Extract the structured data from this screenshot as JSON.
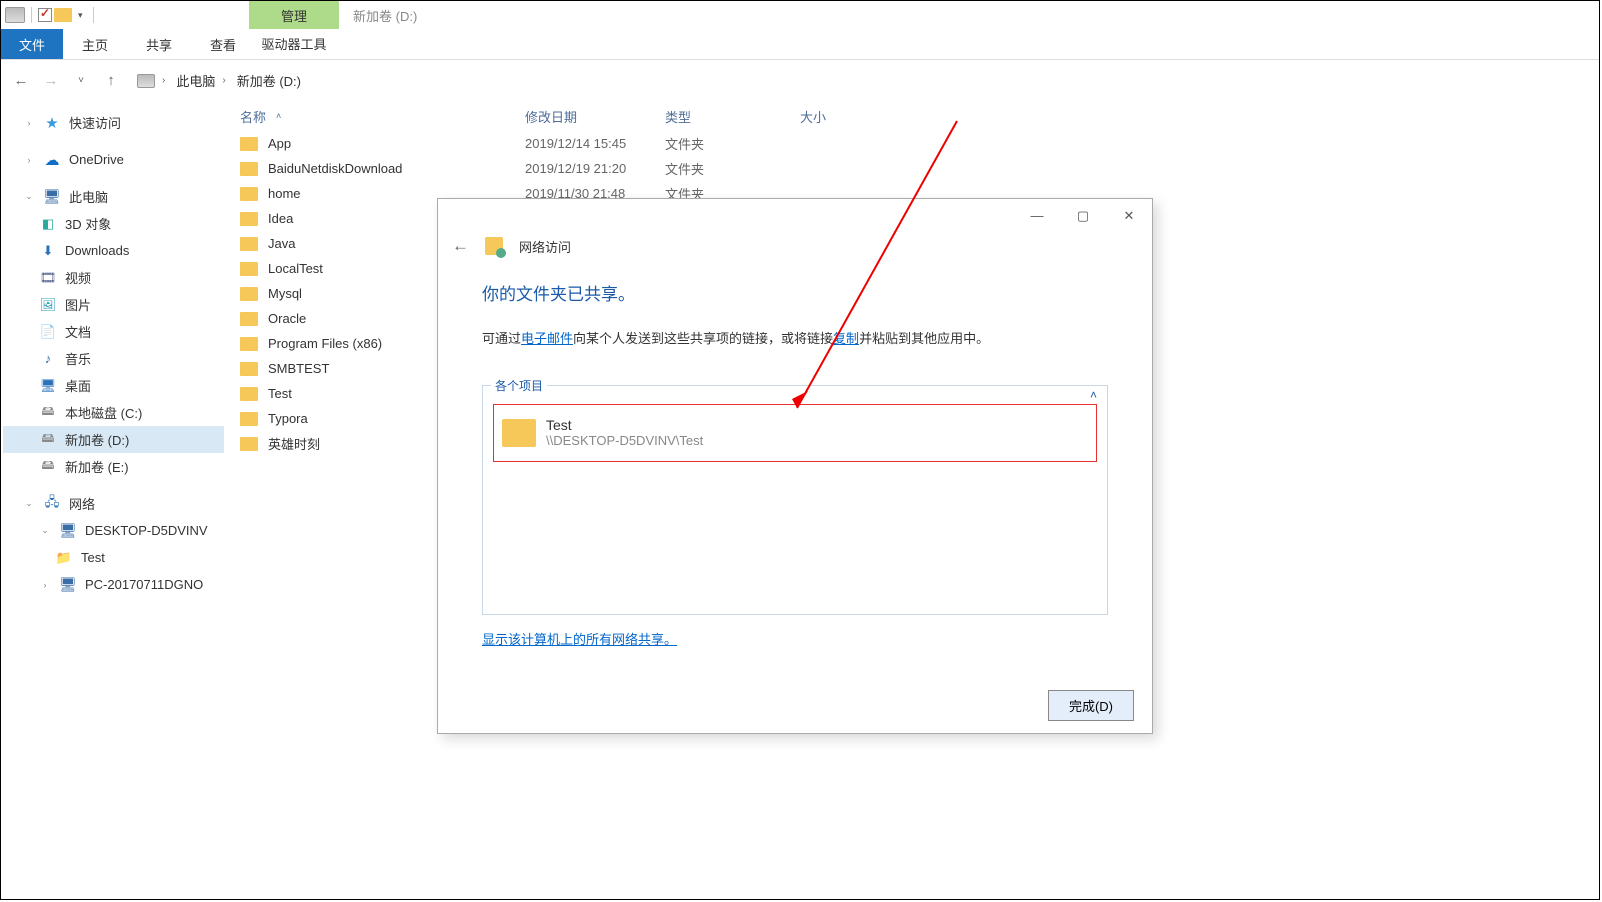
{
  "window": {
    "contextual_tab": "管理",
    "title": "新加卷 (D:)"
  },
  "ribbon": {
    "file": "文件",
    "tabs": [
      "主页",
      "共享",
      "查看"
    ],
    "tool_tab": "驱动器工具"
  },
  "breadcrumb": {
    "pc": "此电脑",
    "drive": "新加卷 (D:)"
  },
  "sidebar": {
    "quick_access": "快速访问",
    "onedrive": "OneDrive",
    "this_pc": "此电脑",
    "objects3d": "3D 对象",
    "downloads": "Downloads",
    "videos": "视频",
    "pictures": "图片",
    "documents": "文档",
    "music": "音乐",
    "desktop": "桌面",
    "c_drive": "本地磁盘 (C:)",
    "d_drive": "新加卷 (D:)",
    "e_drive": "新加卷 (E:)",
    "network": "网络",
    "net_host1": "DESKTOP-D5DVINV",
    "net_share": "Test",
    "net_host2": "PC-20170711DGNO"
  },
  "columns": {
    "name": "名称",
    "modified": "修改日期",
    "type": "类型",
    "size": "大小"
  },
  "files": [
    {
      "name": "App",
      "date": "2019/12/14 15:45",
      "type": "文件夹"
    },
    {
      "name": "BaiduNetdiskDownload",
      "date": "2019/12/19 21:20",
      "type": "文件夹"
    },
    {
      "name": "home",
      "date": "2019/11/30 21:48",
      "type": "文件夹"
    },
    {
      "name": "Idea",
      "date": "",
      "type": ""
    },
    {
      "name": "Java",
      "date": "",
      "type": ""
    },
    {
      "name": "LocalTest",
      "date": "",
      "type": ""
    },
    {
      "name": "Mysql",
      "date": "",
      "type": ""
    },
    {
      "name": "Oracle",
      "date": "",
      "type": ""
    },
    {
      "name": "Program Files (x86)",
      "date": "",
      "type": ""
    },
    {
      "name": "SMBTEST",
      "date": "",
      "type": ""
    },
    {
      "name": "Test",
      "date": "",
      "type": ""
    },
    {
      "name": "Typora",
      "date": "",
      "type": ""
    },
    {
      "name": "英雄时刻",
      "date": "",
      "type": ""
    }
  ],
  "dialog": {
    "header": "网络访问",
    "heading": "你的文件夹已共享。",
    "msg_pre": "可通过",
    "link_email": "电子邮件",
    "msg_mid": "向某个人发送到这些共享项的链接，或将链接",
    "link_copy": "复制",
    "msg_post": "并粘贴到其他应用中。",
    "items_legend": "各个项目",
    "item_name": "Test",
    "item_path": "\\\\DESKTOP-D5DVINV\\Test",
    "show_all": "显示该计算机上的所有网络共享。",
    "done": "完成(D)"
  }
}
